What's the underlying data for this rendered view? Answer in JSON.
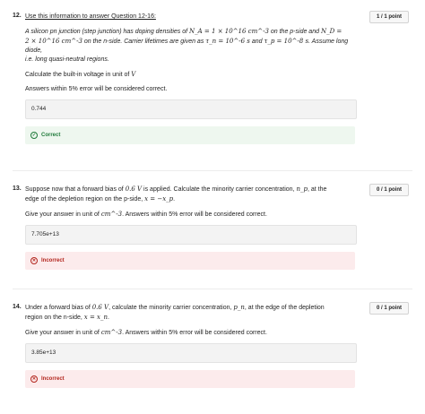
{
  "q12": {
    "number": "12.",
    "points": "1 / 1 point",
    "intro": "Use this information to answer Question 12-16:",
    "scenario_line1": "A silicon pn junction (step junction) has doping densities of ",
    "scenario_na": "N_A = 1 × 10^16 cm^-3",
    "scenario_mid1": " on the p-side and ",
    "scenario_nd": "N_D =",
    "scenario_line2a": "2 × 10^16 cm^-3",
    "scenario_line2b": " on the n-side. Carrier lifetimes are given as ",
    "scenario_tn": "τ_n = 10^-6 s",
    "scenario_and": " and ",
    "scenario_tp": "τ_p = 10^-8 s",
    "scenario_line2c": ". Assume long diode,",
    "scenario_line3": "i.e. long quasi-neutral regions.",
    "prompt": "Calculate the built-in voltage in unit of ",
    "prompt_unit": "V",
    "tolerance": "Answers within 5% error will be considered correct.",
    "answer": "0.744",
    "feedback": "Correct"
  },
  "q13": {
    "number": "13.",
    "points": "0 / 1 point",
    "line1a": "Suppose now that a forward bias of ",
    "bias": "0.6 V",
    "line1b": " is applied. Calculate the minority carrier concentration, ",
    "np": "n_p",
    "line1c": ", at the",
    "line2a": "edge of the depletion region on the p-side, ",
    "xpos": "x = −x_p",
    "line2b": ".",
    "unit_a": "Give your answer in unit of ",
    "unit": "cm^-3",
    "unit_b": ". Answers within 5% error will be considered correct.",
    "answer": "7.705e+13",
    "feedback": "Incorrect"
  },
  "q14": {
    "number": "14.",
    "points": "0 / 1 point",
    "line1a": "Under a forward bias of ",
    "bias": "0.6 V",
    "line1b": ", calculate the minority carrier concentration, ",
    "pn": "p_n",
    "line1c": ", at the edge of the depletion",
    "line2a": "region on the n-side, ",
    "xpos": "x = x_n",
    "line2b": ".",
    "unit_a": "Give your answer in unit of ",
    "unit": "cm^-3",
    "unit_b": ". Answers within 5% error will be considered correct.",
    "answer": "3.85e+13",
    "feedback": "Incorrect"
  }
}
